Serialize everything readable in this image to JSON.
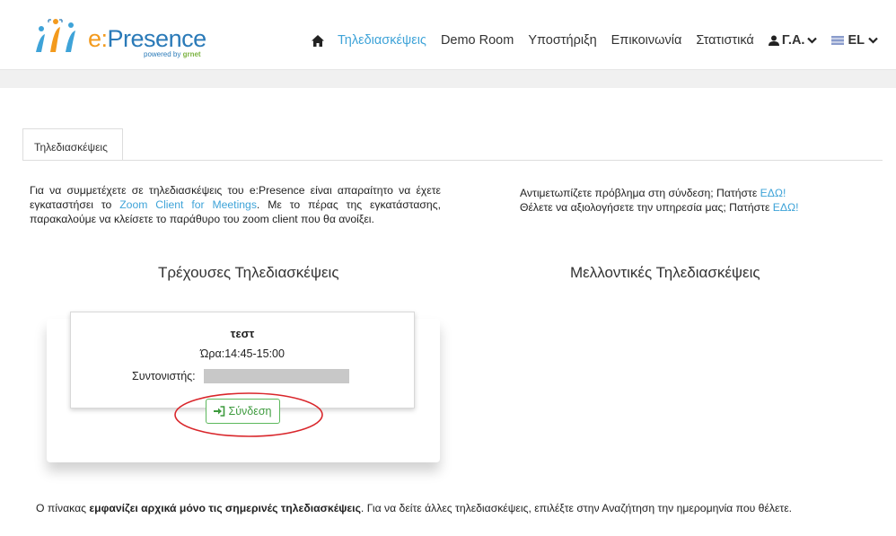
{
  "header": {
    "logo_text_prefix": "e:",
    "logo_text_main": "Presence",
    "logo_sub_prefix": "powered by",
    "logo_sub_brand": "grnet",
    "nav": [
      {
        "label": "Τηλεδιασκέψεις",
        "active": true
      },
      {
        "label": "Demo Room",
        "active": false
      },
      {
        "label": "Υποστήριξη",
        "active": false
      },
      {
        "label": "Επικοινωνία",
        "active": false
      },
      {
        "label": "Στατιστικά",
        "active": false
      }
    ],
    "user_label": "Γ.Α.",
    "lang_label": "EL"
  },
  "tabs": [
    {
      "label": "Τηλεδιασκέψεις"
    }
  ],
  "intro": {
    "part1": "Για να συμμετέχετε σε τηλεδιασκέψεις του e:Presence είναι απαραίτητο να έχετε εγκαταστήσει το ",
    "link": "Zoom Client for Meetings",
    "part2": ". Με το πέρας της εγκατάστασης, παρακαλούμε να κλείσετε το παράθυρο του zoom client που θα ανοίξει."
  },
  "help": {
    "line1_text": "Αντιμετωπίζετε πρόβλημα στη σύνδεση; Πατήστε ",
    "line1_link": "ΕΔΩ!",
    "line2_text": "Θέλετε να αξιολογήσετε την υπηρεσία μας; Πατήστε ",
    "line2_link": "ΕΔΩ!"
  },
  "sections": {
    "current_title": "Τρέχουσες Τηλεδιασκέψεις",
    "future_title": "Μελλοντικές Τηλεδιασκέψεις"
  },
  "meeting": {
    "name": "τεστ",
    "time": "Ώρα:14:45-15:00",
    "coordinator_label": "Συντονιστής:",
    "join_label": "Σύνδεση"
  },
  "footer": {
    "part1": "Ο πίνακας ",
    "bold": "εμφανίζει αρχικά μόνο τις σημερινές τηλεδιασκέψεις",
    "part2": ". Για να δείτε άλλες τηλεδιασκέψεις, επιλέξτε στην Αναζήτηση την ημερομηνία που θέλετε."
  },
  "colors": {
    "accent": "#3ea3d8",
    "logo_orange": "#f39a1d",
    "success": "#5cb85c",
    "annotation": "#d9262b"
  }
}
